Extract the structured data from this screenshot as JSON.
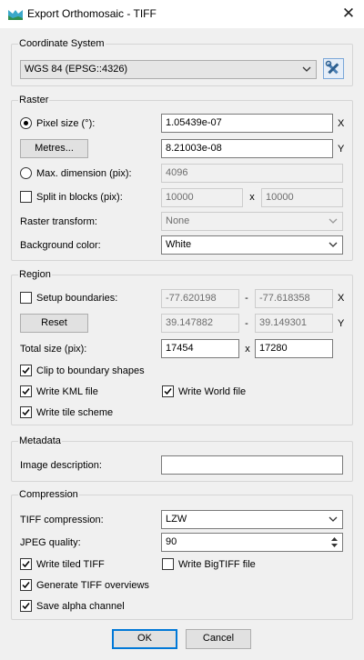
{
  "window": {
    "title": "Export Orthomosaic - TIFF"
  },
  "coordinate_system": {
    "heading": "Coordinate System",
    "selected": "WGS 84 (EPSG::4326)"
  },
  "raster": {
    "heading": "Raster",
    "pixel_size_label": "Pixel size (°):",
    "pixel_size_x": "1.05439e-07",
    "pixel_size_y": "8.21003e-08",
    "metres_button": "Metres...",
    "axis_x": "X",
    "axis_y": "Y",
    "max_dim_label": "Max. dimension (pix):",
    "max_dim_value": "4096",
    "split_label": "Split in blocks (pix):",
    "split_w": "10000",
    "split_x": "x",
    "split_h": "10000",
    "transform_label": "Raster transform:",
    "transform_value": "None",
    "bg_label": "Background color:",
    "bg_value": "White"
  },
  "region": {
    "heading": "Region",
    "setup_label": "Setup boundaries:",
    "x_min": "-77.620198",
    "x_max": "-77.618358",
    "y_min": "39.147882",
    "y_max": "39.149301",
    "dash": "-",
    "axis_x": "X",
    "axis_y": "Y",
    "reset_button": "Reset",
    "total_label": "Total size (pix):",
    "total_w": "17454",
    "total_x": "x",
    "total_h": "17280",
    "clip_label": "Clip to boundary shapes",
    "kml_label": "Write KML file",
    "world_label": "Write World file",
    "tile_label": "Write tile scheme"
  },
  "metadata": {
    "heading": "Metadata",
    "desc_label": "Image description:",
    "desc_value": ""
  },
  "compression": {
    "heading": "Compression",
    "tiff_label": "TIFF compression:",
    "tiff_value": "LZW",
    "jpeg_label": "JPEG quality:",
    "jpeg_value": "90",
    "tiled_label": "Write tiled TIFF",
    "bigtiff_label": "Write BigTIFF file",
    "overviews_label": "Generate TIFF overviews",
    "alpha_label": "Save alpha channel"
  },
  "buttons": {
    "ok": "OK",
    "cancel": "Cancel"
  },
  "state": {
    "pixel_size_selected": true,
    "max_dim_selected": false,
    "split_checked": false,
    "setup_checked": false,
    "clip_checked": true,
    "kml_checked": true,
    "world_checked": true,
    "tile_checked": true,
    "tiled_checked": true,
    "bigtiff_checked": false,
    "overviews_checked": true,
    "alpha_checked": true
  },
  "colors": {
    "accent": "#0078d7",
    "window_bg": "#f0f0f0",
    "border": "#d5d5d5"
  }
}
